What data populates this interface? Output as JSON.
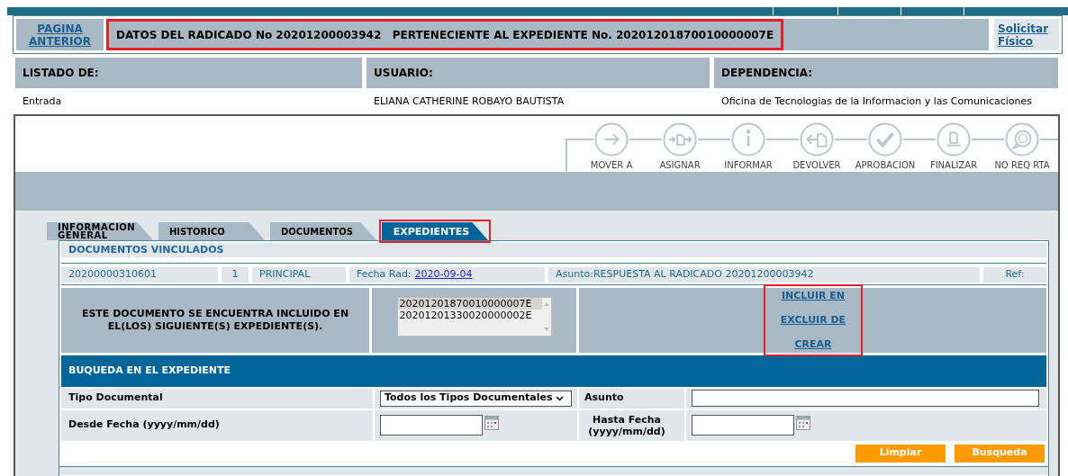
{
  "header": {
    "back_link": "PAGINA ANTERIOR",
    "title": "DATOS DEL RADICADO No 20201200003942   PERTENECIENTE AL EXPEDIENTE No. 20201201870010000007E",
    "title_highlighted": true,
    "request_link": "Solicitar Físico"
  },
  "info": [
    {
      "label": "LISTADO DE:",
      "value": "Entrada"
    },
    {
      "label": "USUARIO:",
      "value": "ELIANA CATHERINE ROBAYO BAUTISTA"
    },
    {
      "label": "DEPENDENCIA:",
      "value": "Oficina de Tecnologias de la Informacion y las Comunicaciones"
    }
  ],
  "actions": [
    {
      "kind": "move",
      "label": "MOVER A"
    },
    {
      "kind": "assign",
      "label": "ASIGNAR"
    },
    {
      "kind": "info",
      "label": "INFORMAR"
    },
    {
      "kind": "return",
      "label": "DEVOLVER"
    },
    {
      "kind": "approve",
      "label": "APROBACION"
    },
    {
      "kind": "finish",
      "label": "FINALIZAR"
    },
    {
      "kind": "noreply",
      "label": "NO REQ RTA"
    }
  ],
  "tabs": [
    {
      "label": "INFORMACION GENERAL",
      "selected": false,
      "highlighted": false
    },
    {
      "label": "HISTORICO",
      "selected": false,
      "highlighted": false
    },
    {
      "label": "DOCUMENTOS",
      "selected": false,
      "highlighted": false
    },
    {
      "label": "EXPEDIENTES",
      "selected": true,
      "highlighted": true
    }
  ],
  "linked_documents": {
    "title": "DOCUMENTOS VINCULADOS",
    "number": "20200000310601",
    "count": "1",
    "type": "PRINCIPAL",
    "date_label": "Fecha Rad:",
    "date_link": "2020-09-04",
    "subject": "Asunto:RESPUESTA AL RADICADO 20201200003942",
    "ref": "Ref:"
  },
  "expedientes": {
    "message": "ESTE DOCUMENTO SE ENCUENTRA INCLUIDO EN EL(LOS) SIGUIENTE(S) EXPEDIENTE(S).",
    "list": [
      {
        "text": "20201201870010000007E",
        "selected": true
      },
      {
        "text": "20201201330020000002E",
        "selected": false
      }
    ],
    "links": [
      "INCLUIR EN",
      "EXCLUIR DE",
      "CREAR"
    ],
    "links_highlighted": true
  },
  "search": {
    "title": "BUQUEDA EN EL EXPEDIENTE",
    "type_label": "Tipo Documental",
    "type_value": "Todos los Tipos Documentales",
    "subject_label": "Asunto",
    "from_label": "Desde Fecha (yyyy/mm/dd)",
    "to_label": "Hasta Fecha (yyyy/mm/dd)",
    "buttons": [
      "Limpiar",
      "Busqueda"
    ]
  }
}
